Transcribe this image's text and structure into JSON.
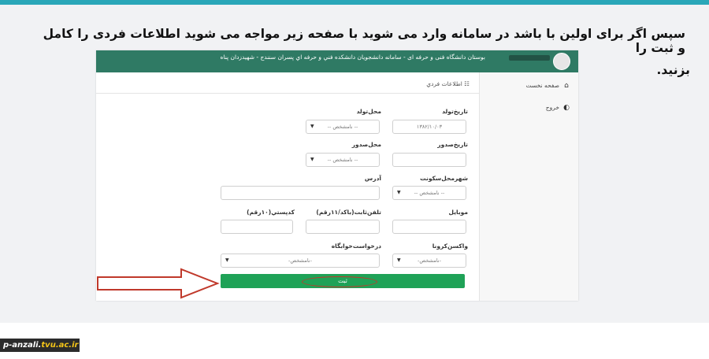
{
  "instruction": {
    "line1": "سپس اگر برای اولین با باشد در سامانه وارد می شوید با صفحه زیر مواجه می شوید اطلاعات فردی را کامل و ثبت را",
    "line2": "بزنید."
  },
  "app": {
    "brand_line1": "بوستان دانشگاه فنی و حرفه ای - سامانه دانشجویان دانشکده فني و حرفه اي پسران سنندج - شهیدزدان پناه",
    "sidebar": [
      {
        "label": "صفحه نخست",
        "icon": "home-icon"
      },
      {
        "label": "خروج",
        "icon": "toggle-icon"
      }
    ],
    "panel_title": "اطلاعات فردي",
    "form": {
      "birth_date_label": "تاریخ‌تولد",
      "birth_date_value": "۱۳۸۲/۱۰/۰۳",
      "birth_place_label": "محل‌تولد",
      "birth_place_value": "-- نامشخص --",
      "issue_date_label": "تاریخ‌صدور",
      "issue_place_label": "محل‌صدور",
      "issue_place_value": "-- نامشخص --",
      "residence_city_label": "شهرمحل‌سکونت",
      "residence_city_value": "-- نامشخص --",
      "address_label": "آدرس",
      "mobile_label": "موبایل",
      "landline_label": "تلفن‌ثابت(باکد/۱۱رقم)",
      "postal_label": "کدپستي(۱۰رقم)",
      "covid_label": "واکسن‌کرونا",
      "covid_value": "-نامشخص-",
      "dorm_label": "درخواست‌خوابگاه",
      "dorm_value": "-نامشخص-",
      "submit_label": "ثبت"
    }
  },
  "footer": {
    "host": "p-anzali.",
    "domain": "tvu.ac.ir"
  },
  "colors": {
    "header_green": "#2f7a64",
    "submit_green": "#1fa257",
    "highlight_red": "#c0392b",
    "top_accent": "#2aa7b8"
  }
}
